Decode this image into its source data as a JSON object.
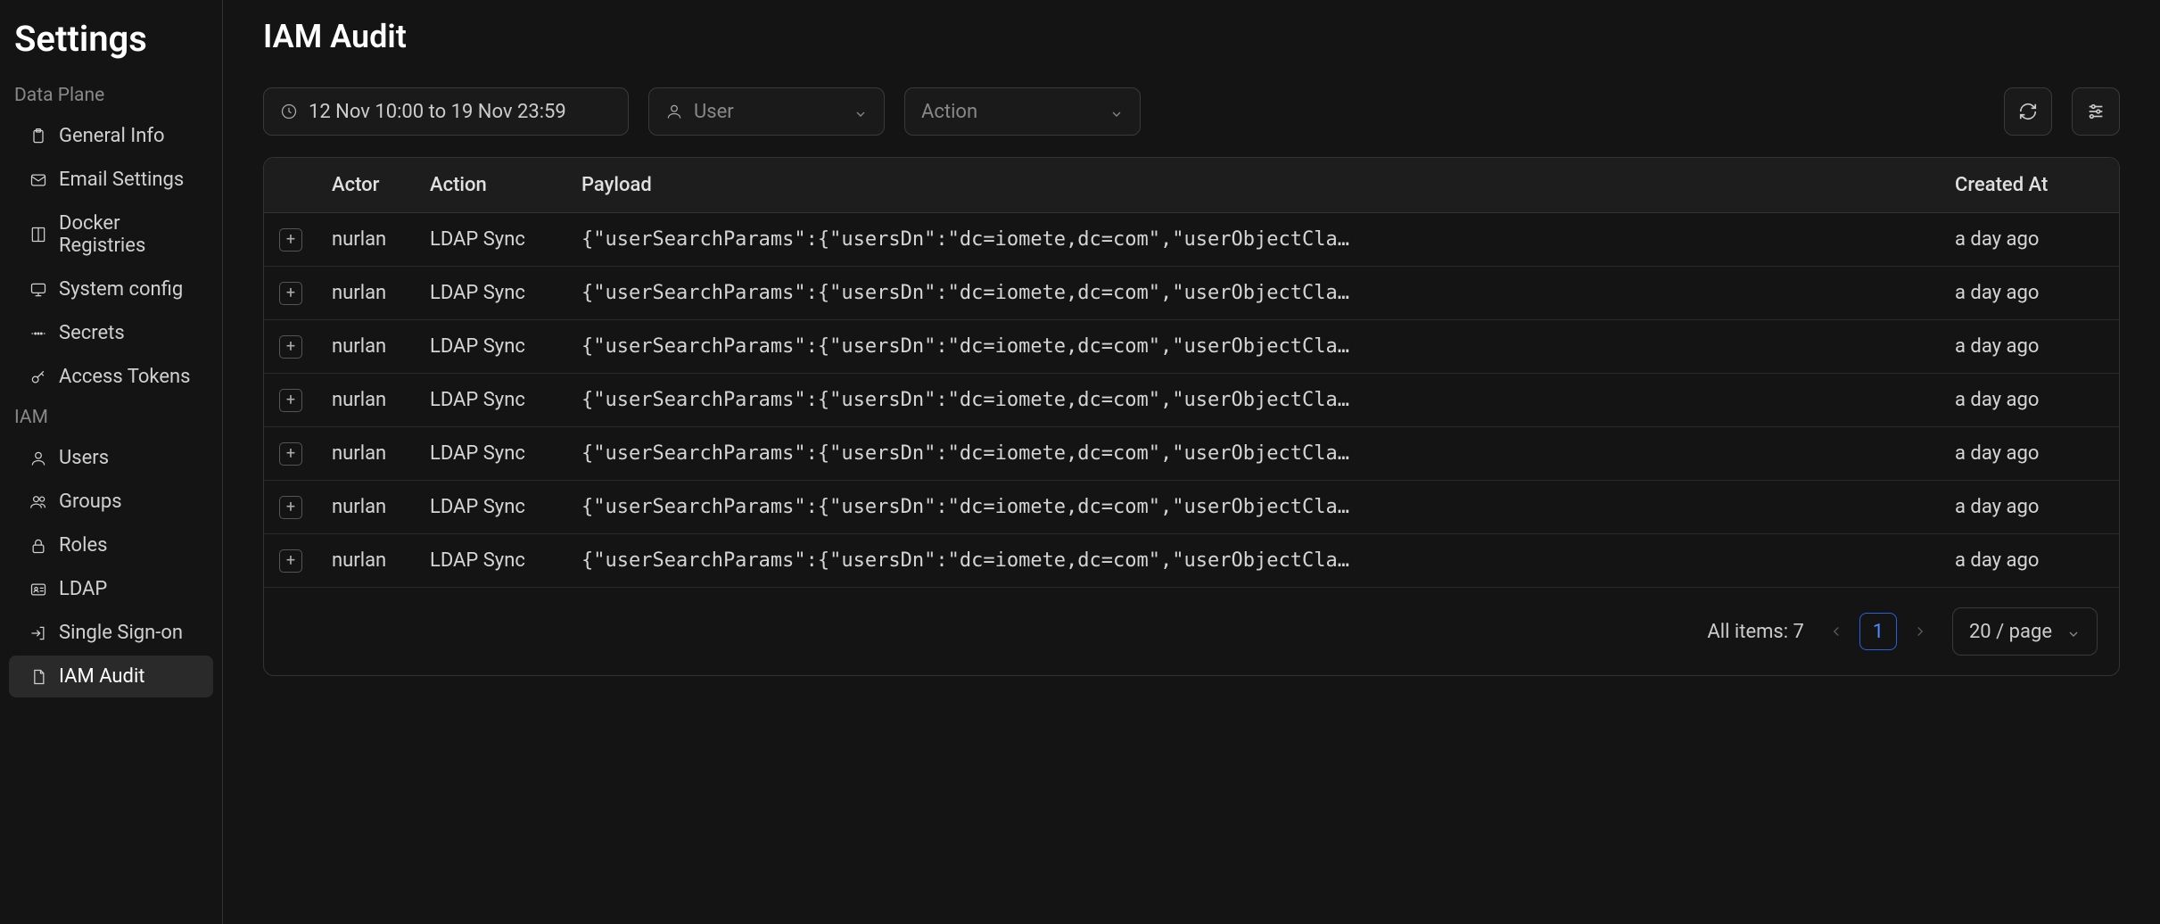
{
  "sidebar": {
    "title": "Settings",
    "sections": [
      {
        "label": "Data Plane",
        "items": [
          {
            "id": "general-info",
            "label": "General Info",
            "icon": "clipboard"
          },
          {
            "id": "email-settings",
            "label": "Email Settings",
            "icon": "mail"
          },
          {
            "id": "docker-registries",
            "label": "Docker Registries",
            "icon": "book"
          },
          {
            "id": "system-config",
            "label": "System config",
            "icon": "monitor"
          },
          {
            "id": "secrets",
            "label": "Secrets",
            "icon": "password"
          },
          {
            "id": "access-tokens",
            "label": "Access Tokens",
            "icon": "key"
          }
        ]
      },
      {
        "label": "IAM",
        "items": [
          {
            "id": "users",
            "label": "Users",
            "icon": "user"
          },
          {
            "id": "groups",
            "label": "Groups",
            "icon": "users"
          },
          {
            "id": "roles",
            "label": "Roles",
            "icon": "lock"
          },
          {
            "id": "ldap",
            "label": "LDAP",
            "icon": "idcard"
          },
          {
            "id": "sso",
            "label": "Single Sign-on",
            "icon": "login"
          },
          {
            "id": "iam-audit",
            "label": "IAM Audit",
            "icon": "file",
            "active": true
          }
        ]
      }
    ]
  },
  "page": {
    "title": "IAM Audit"
  },
  "filters": {
    "date_range": "12 Nov 10:00 to 19 Nov 23:59",
    "user_placeholder": "User",
    "action_placeholder": "Action"
  },
  "table": {
    "columns": [
      "Actor",
      "Action",
      "Payload",
      "Created At"
    ],
    "rows": [
      {
        "actor": "nurlan",
        "action": "LDAP Sync",
        "payload": "{\"userSearchParams\":{\"usersDn\":\"dc=iomete,dc=com\",\"userObjectCla…",
        "created": "a day ago"
      },
      {
        "actor": "nurlan",
        "action": "LDAP Sync",
        "payload": "{\"userSearchParams\":{\"usersDn\":\"dc=iomete,dc=com\",\"userObjectCla…",
        "created": "a day ago"
      },
      {
        "actor": "nurlan",
        "action": "LDAP Sync",
        "payload": "{\"userSearchParams\":{\"usersDn\":\"dc=iomete,dc=com\",\"userObjectCla…",
        "created": "a day ago"
      },
      {
        "actor": "nurlan",
        "action": "LDAP Sync",
        "payload": "{\"userSearchParams\":{\"usersDn\":\"dc=iomete,dc=com\",\"userObjectCla…",
        "created": "a day ago"
      },
      {
        "actor": "nurlan",
        "action": "LDAP Sync",
        "payload": "{\"userSearchParams\":{\"usersDn\":\"dc=iomete,dc=com\",\"userObjectCla…",
        "created": "a day ago"
      },
      {
        "actor": "nurlan",
        "action": "LDAP Sync",
        "payload": "{\"userSearchParams\":{\"usersDn\":\"dc=iomete,dc=com\",\"userObjectCla…",
        "created": "a day ago"
      },
      {
        "actor": "nurlan",
        "action": "LDAP Sync",
        "payload": "{\"userSearchParams\":{\"usersDn\":\"dc=iomete,dc=com\",\"userObjectCla…",
        "created": "a day ago"
      }
    ]
  },
  "pagination": {
    "summary": "All items: 7",
    "current_page": "1",
    "page_size_label": "20 / page"
  }
}
